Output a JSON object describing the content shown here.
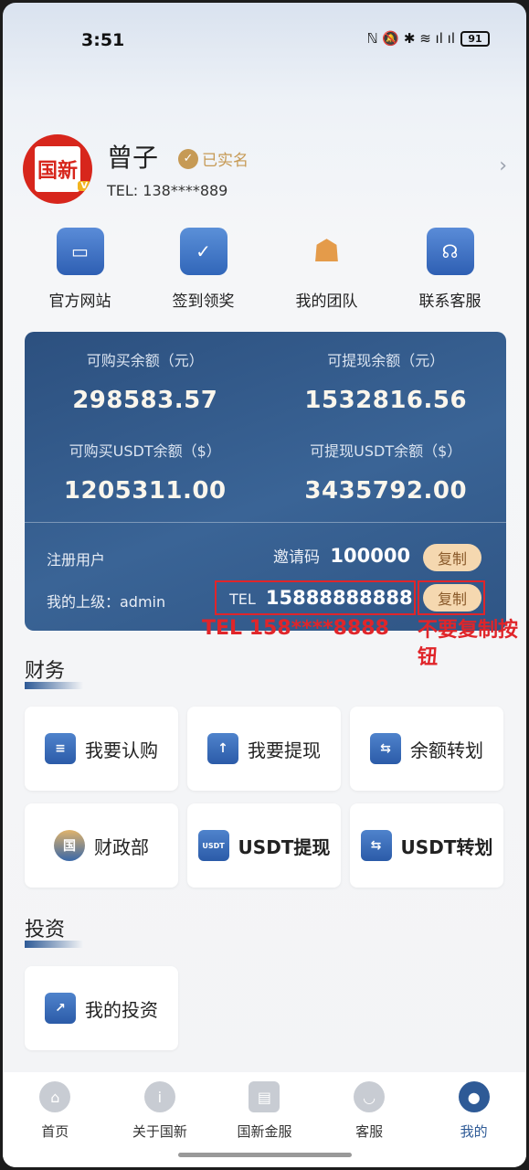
{
  "status": {
    "time": "3:51",
    "icons": "ℕ 🔕 ✱ ≋ ıl ıl",
    "battery": "91"
  },
  "profile": {
    "avatar_text": "国新",
    "avatar_badge": "V",
    "name": "曾子",
    "verified_label": "已实名",
    "tel": "TEL: 138****889",
    "arrow": "›"
  },
  "quick": [
    {
      "label": "官方网站",
      "icon": "monitor-icon"
    },
    {
      "label": "签到领奖",
      "icon": "calendar-check-icon"
    },
    {
      "label": "我的团队",
      "icon": "team-icon"
    },
    {
      "label": "联系客服",
      "icon": "headset-icon"
    }
  ],
  "balance": {
    "buy_label": "可购买余额（元）",
    "buy_value": "298583.57",
    "withdraw_label": "可提现余额（元）",
    "withdraw_value": "1532816.56",
    "buy_usdt_label": "可购买USDT余额（$）",
    "buy_usdt_value": "1205311.00",
    "withdraw_usdt_label": "可提现USDT余额（$）",
    "withdraw_usdt_value": "3435792.00",
    "registered_label": "注册用户",
    "invite_label": "邀请码",
    "invite_code": "100000",
    "copy_label": "复制",
    "superior_label": "我的上级：admin",
    "tel_label": "TEL",
    "tel_value": "15888888888"
  },
  "annotations": {
    "tel_note": "TEL 158****8888",
    "copy_note": "不要复制按钮"
  },
  "finance": {
    "title": "财务",
    "items": [
      "我要认购",
      "我要提现",
      "余额转划",
      "财政部",
      "USDT提现",
      "USDT转划"
    ]
  },
  "invest": {
    "title": "投资",
    "items": [
      "我的投资"
    ]
  },
  "tabs": [
    "首页",
    "关于国新",
    "国新金服",
    "客服",
    "我的"
  ],
  "colors": {
    "accent": "#2e5a96",
    "copy_button": "#f5d8b0",
    "annotation": "#e0252a"
  }
}
